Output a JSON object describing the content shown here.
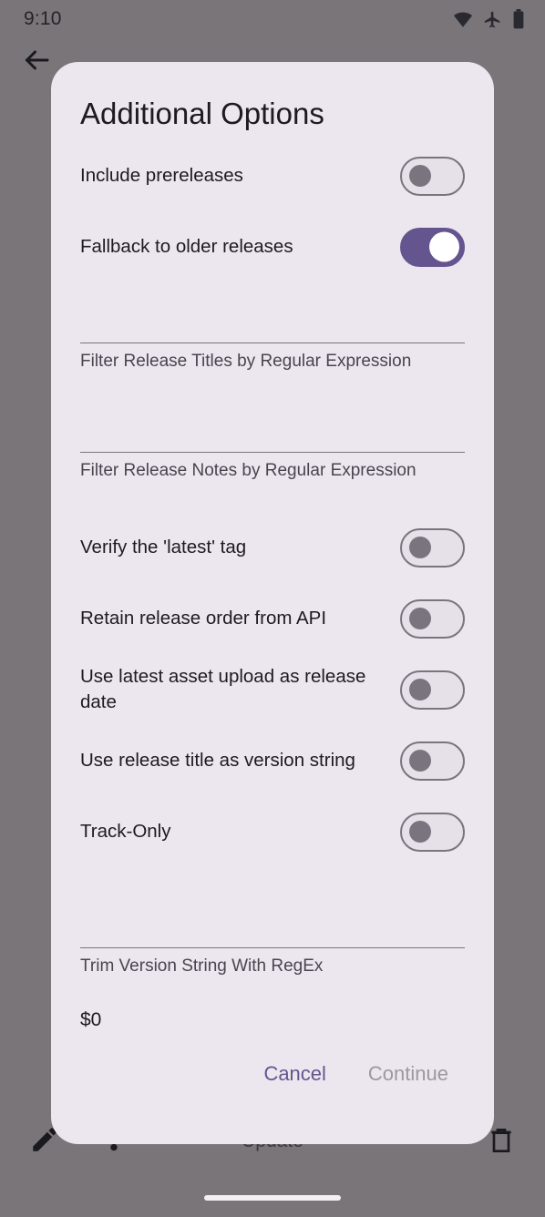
{
  "status_bar": {
    "time": "9:10",
    "icons": [
      "wifi-icon",
      "airplane-mode-icon",
      "battery-icon"
    ]
  },
  "background_app": {
    "back_icon": "back-arrow-icon",
    "bottom_bar": {
      "edit_icon": "pencil-icon",
      "branch_icon": "fork-icon",
      "center_label": "Update",
      "delete_icon": "trash-icon"
    }
  },
  "dialog": {
    "title": "Additional Options",
    "switch_rows": [
      {
        "label": "Include prereleases",
        "state": "off"
      },
      {
        "label": "Fallback to older releases",
        "state": "on"
      }
    ],
    "fields": [
      {
        "value": "",
        "helper": "Filter Release Titles by Regular Expression"
      },
      {
        "value": "",
        "helper": "Filter Release Notes by Regular Expression"
      }
    ],
    "switch_rows_2": [
      {
        "label": "Verify the 'latest' tag",
        "state": "off"
      },
      {
        "label": "Retain release order from API",
        "state": "off"
      },
      {
        "label": "Use latest asset upload as release date",
        "state": "off"
      },
      {
        "label": "Use release title as version string",
        "state": "off"
      },
      {
        "label": "Track-Only",
        "state": "off"
      }
    ],
    "trim_field": {
      "value": "$0",
      "helper": "Trim Version String With RegEx"
    },
    "actions": {
      "cancel_label": "Cancel",
      "continue_label": "Continue"
    }
  },
  "colors": {
    "accent": "#65558F",
    "surface": "#ECE6EF",
    "scrim": "#7A7578",
    "on_surface": "#1D1B20",
    "outline": "#79747E",
    "disabled": "#9D97A1"
  }
}
